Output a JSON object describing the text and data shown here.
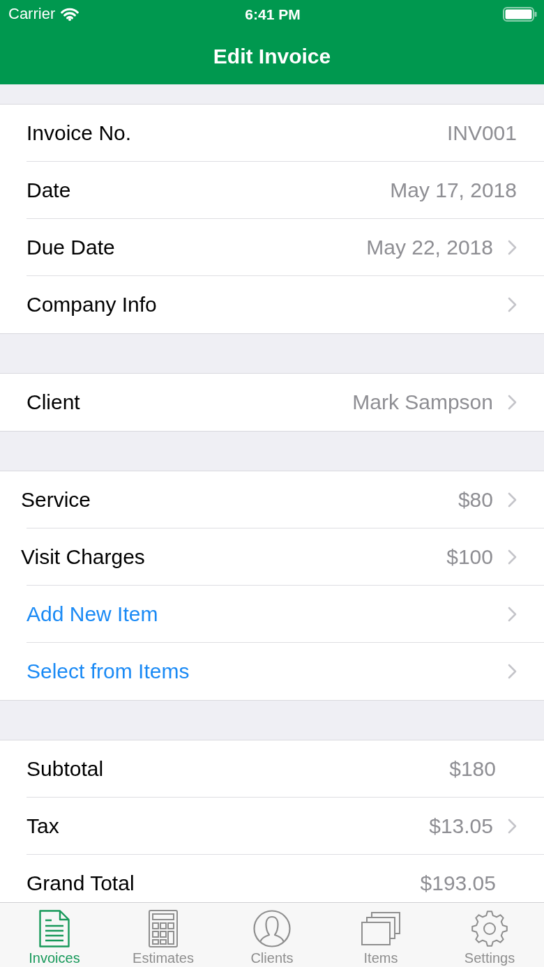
{
  "status_bar": {
    "carrier": "Carrier",
    "time": "6:41 PM"
  },
  "nav_bar": {
    "title": "Edit Invoice"
  },
  "sections": [
    {
      "rows": [
        {
          "kind": "field",
          "label": "Invoice No.",
          "value": "INV001",
          "chevron": false
        },
        {
          "kind": "field",
          "label": "Date",
          "value": "May 17, 2018",
          "chevron": false
        },
        {
          "kind": "field",
          "label": "Due Date",
          "value": "May 22, 2018",
          "chevron": true
        },
        {
          "kind": "field",
          "label": "Company Info",
          "chevron": true
        }
      ]
    },
    {
      "rows": [
        {
          "kind": "field",
          "label": "Client",
          "value": "Mark Sampson",
          "chevron": true
        }
      ]
    },
    {
      "rows": [
        {
          "kind": "line_item",
          "label": "Service",
          "value": "$80",
          "chevron": true
        },
        {
          "kind": "line_item",
          "label": "Visit Charges",
          "value": "$100",
          "chevron": true
        },
        {
          "kind": "action",
          "label": "Add New Item",
          "chevron": true
        },
        {
          "kind": "action",
          "label": "Select from Items",
          "chevron": true
        }
      ]
    },
    {
      "rows": [
        {
          "kind": "total",
          "label": "Subtotal",
          "value": "$180",
          "chevron": false
        },
        {
          "kind": "total",
          "label": "Tax",
          "value": "$13.05",
          "chevron": true
        },
        {
          "kind": "total",
          "label": "Grand Total",
          "value": "$193.05",
          "chevron": false
        }
      ]
    }
  ],
  "tab_bar": {
    "tabs": [
      {
        "label": "Invoices",
        "selected": true
      },
      {
        "label": "Estimates",
        "selected": false
      },
      {
        "label": "Clients",
        "selected": false
      },
      {
        "label": "Items",
        "selected": false
      },
      {
        "label": "Settings",
        "selected": false
      }
    ]
  }
}
